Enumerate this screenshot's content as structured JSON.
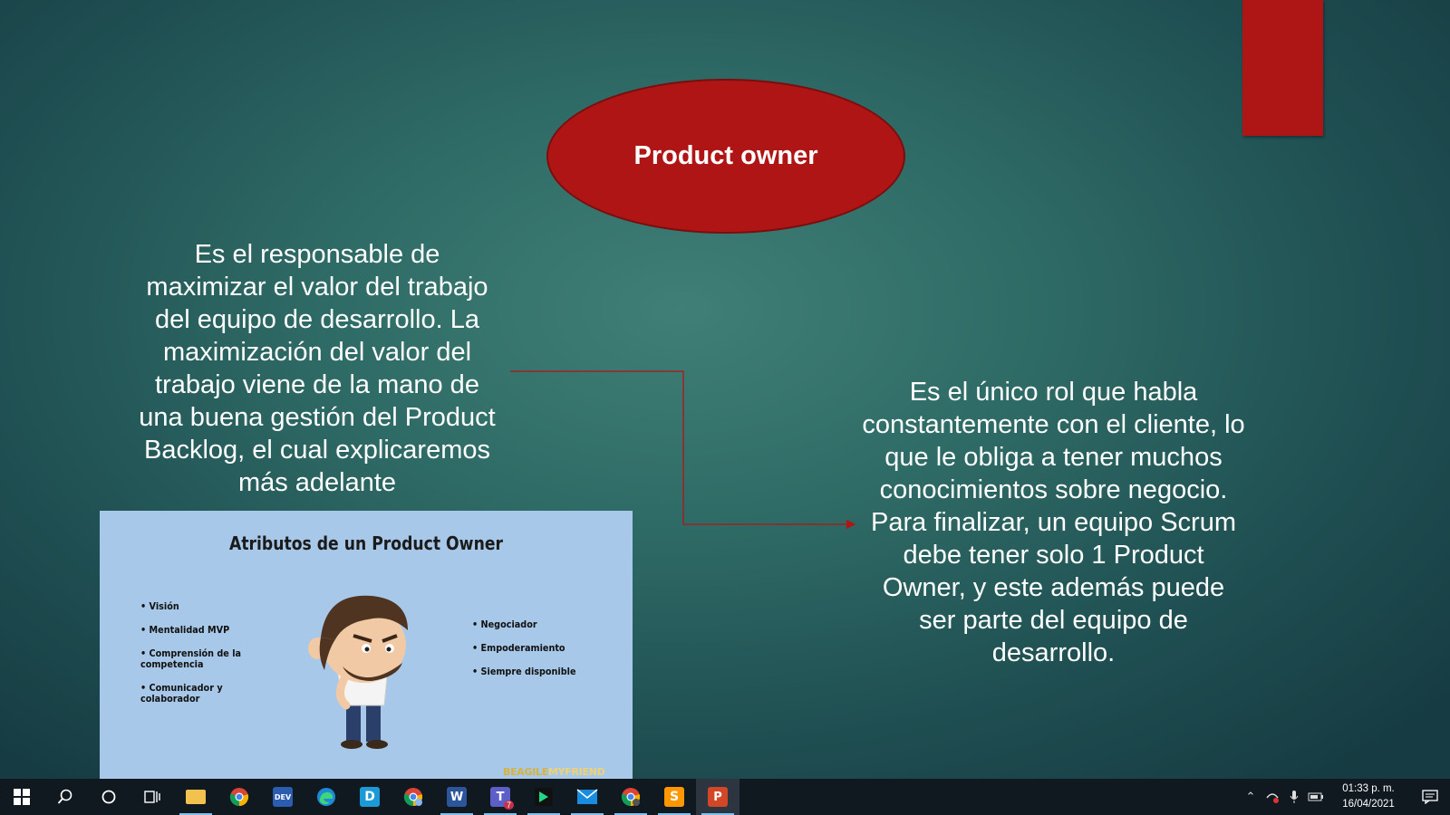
{
  "slide": {
    "title": "Product owner",
    "left_text": "Es el responsable de maximizar el valor del trabajo del equipo de desarrollo. La maximización del valor del trabajo viene de la mano de una buena gestión del Product Backlog, el cual explicaremos más adelante",
    "right_text": "Es el único rol que habla constantemente con el cliente, lo que le obliga a tener muchos conocimientos sobre negocio. Para finalizar, un equipo Scrum debe tener solo 1 Product Owner, y este además puede ser parte del equipo de desarrollo.",
    "accent_color": "#ae1616"
  },
  "infographic": {
    "title": "Atributos de un Product Owner",
    "attributes_left": [
      "Visión",
      "Mentalidad MVP",
      "Comprensión de la competencia",
      "Comunicador y colaborador"
    ],
    "attributes_right": [
      "Negociador",
      "Empoderamiento",
      "Siempre disponible"
    ],
    "logo_text_a": "BEAGILE",
    "logo_text_b": "MYFRIEND",
    "background": "#a7c8e8"
  },
  "taskbar": {
    "apps": [
      {
        "name": "file-explorer-icon",
        "active": true
      },
      {
        "name": "chrome-icon",
        "active": false
      },
      {
        "name": "dev-c-icon",
        "label": "DEV",
        "active": false
      },
      {
        "name": "edge-icon",
        "active": false
      },
      {
        "name": "dia-icon",
        "label": "D",
        "active": false
      },
      {
        "name": "chrome-profile-icon",
        "active": false
      },
      {
        "name": "word-icon",
        "label": "W",
        "active": true
      },
      {
        "name": "teams-icon",
        "label": "T",
        "badge": "7",
        "active": true
      },
      {
        "name": "pycharm-icon",
        "active": true
      },
      {
        "name": "mail-icon",
        "active": true
      },
      {
        "name": "chrome-alt-icon",
        "active": true
      },
      {
        "name": "sublime-icon",
        "label": "S",
        "active": true
      },
      {
        "name": "powerpoint-icon",
        "label": "P",
        "active": true,
        "current": true
      }
    ],
    "time": "01:33 p. m.",
    "date": "16/04/2021"
  }
}
